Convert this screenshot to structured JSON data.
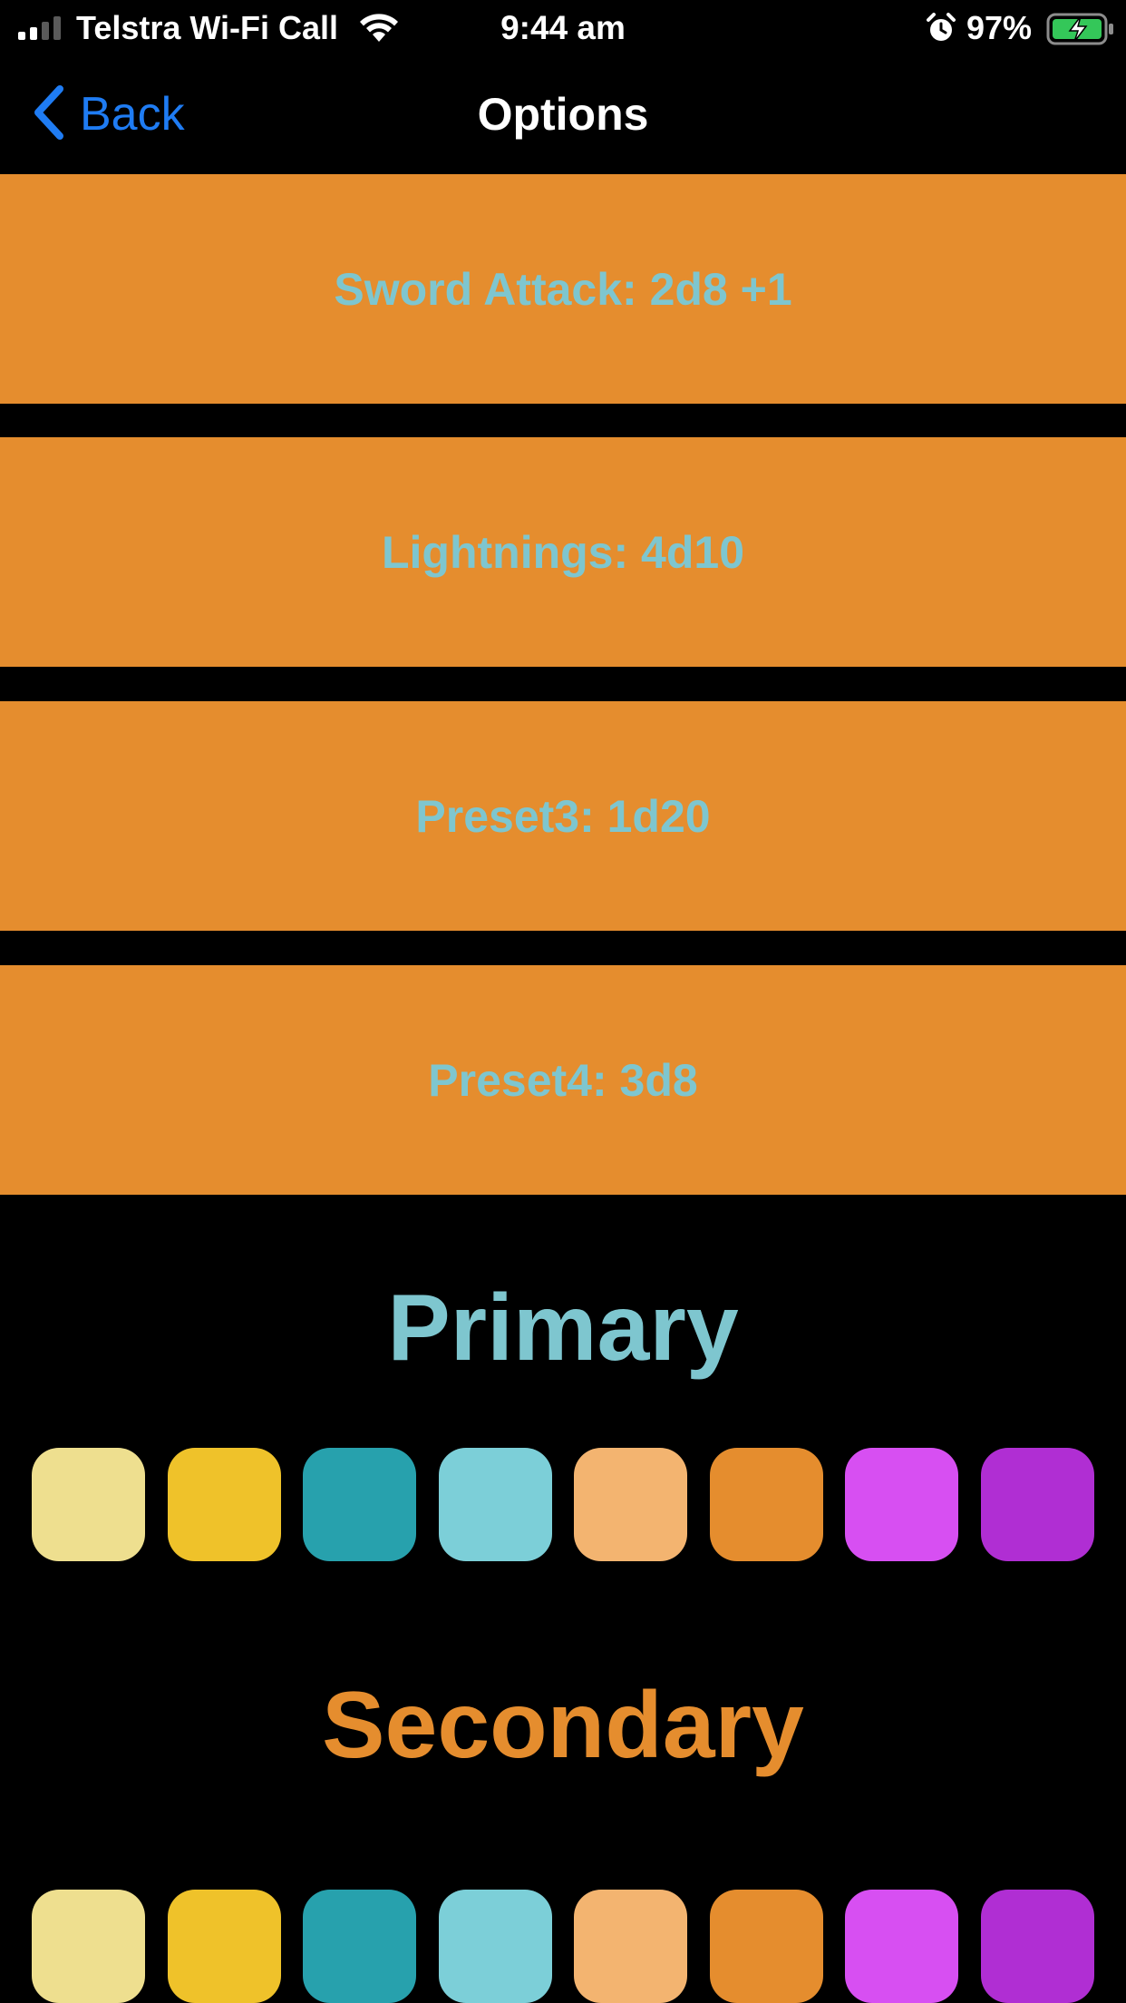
{
  "status_bar": {
    "carrier": "Telstra Wi-Fi Call",
    "time": "9:44 am",
    "battery_percent": "97%",
    "icons": [
      "signal-icon",
      "wifi-icon",
      "alarm-icon",
      "battery-charging-icon"
    ]
  },
  "nav": {
    "back_label": "Back",
    "title": "Options"
  },
  "presets": [
    {
      "label": "Sword Attack: 2d8 +1"
    },
    {
      "label": "Lightnings: 4d10"
    },
    {
      "label": "Preset3: 1d20"
    },
    {
      "label": "Preset4: 3d8"
    }
  ],
  "primary": {
    "title": "Primary",
    "title_color": "#7ec6cf"
  },
  "secondary": {
    "title": "Secondary",
    "title_color": "#e58d2e"
  },
  "swatch_colors": [
    "#eedf8f",
    "#efc22a",
    "#27a1ad",
    "#7ccfd8",
    "#f3b470",
    "#e58d2e",
    "#d74ff2",
    "#b02ed3"
  ],
  "colors": {
    "preset_background": "#e58d2e",
    "preset_text": "#7ec6cf",
    "accent": "#1f7cf3",
    "background": "#000000"
  }
}
